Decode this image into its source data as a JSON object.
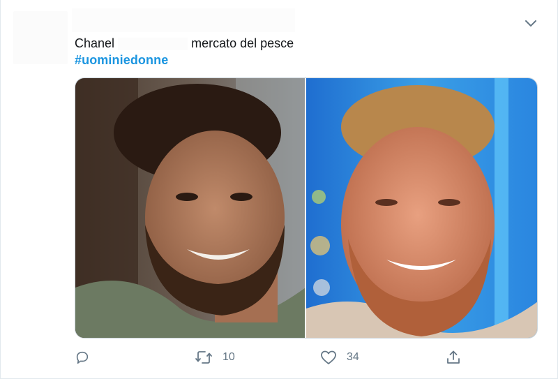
{
  "tweet": {
    "text_part1": "Chanel",
    "text_part2": "mercato del pesce",
    "hashtag": "#uominiedonne",
    "menu_icon": "chevron-down-icon"
  },
  "media": {
    "left_photo": "smiling-bearded-man-photo",
    "right_photo": "smiling-bearded-man-tv-photo"
  },
  "actions": {
    "reply_icon": "reply-icon",
    "retweet_icon": "retweet-icon",
    "retweet_count": "10",
    "like_icon": "heart-icon",
    "like_count": "34",
    "share_icon": "share-icon"
  },
  "colors": {
    "text": "#14171a",
    "link": "#1b95e0",
    "muted": "#657786",
    "border": "#ccd6dd"
  }
}
